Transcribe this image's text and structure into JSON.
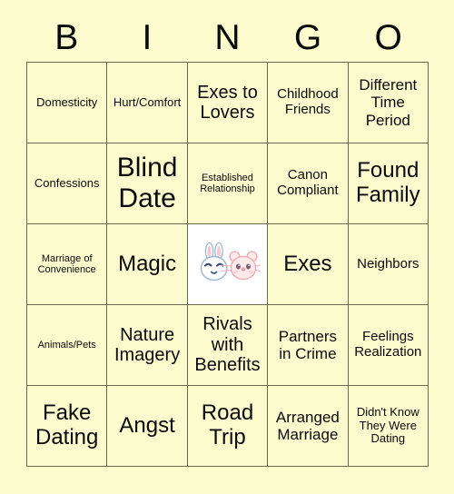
{
  "card": {
    "header_letters": [
      "B",
      "I",
      "N",
      "G",
      "O"
    ],
    "background_color": "#fcfbce",
    "grid_line_color": "#6b6a4a",
    "text_color": "#0a0a0a",
    "free_space_background": "#ffffff"
  },
  "grid": {
    "rows": 5,
    "columns": 5,
    "cells": [
      {
        "id": "b1",
        "text": "Domesticity",
        "size": "sm",
        "type": "text"
      },
      {
        "id": "i1",
        "text": "Hurt/Comfort",
        "size": "sm",
        "type": "text"
      },
      {
        "id": "n1",
        "text": "Exes to Lovers",
        "size": "xl",
        "type": "text"
      },
      {
        "id": "g1",
        "text": "Childhood Friends",
        "size": "md",
        "type": "text"
      },
      {
        "id": "o1",
        "text": "Different Time Period",
        "size": "lg",
        "type": "text"
      },
      {
        "id": "b2",
        "text": "Confessions",
        "size": "sm",
        "type": "text"
      },
      {
        "id": "i2",
        "text": "Blind Date",
        "size": "3xl",
        "type": "text"
      },
      {
        "id": "n2",
        "text": "Established Relationship",
        "size": "xs",
        "type": "text"
      },
      {
        "id": "g2",
        "text": "Canon Compliant",
        "size": "md",
        "type": "text"
      },
      {
        "id": "o2",
        "text": "Found Family",
        "size": "2xl",
        "type": "text"
      },
      {
        "id": "b3",
        "text": "Marriage of Convenience",
        "size": "xs",
        "type": "text"
      },
      {
        "id": "i3",
        "text": "Magic",
        "size": "2xl",
        "type": "text"
      },
      {
        "id": "n3",
        "text": "",
        "size": "md",
        "type": "free-space",
        "art": "bunny-and-cat-illustration"
      },
      {
        "id": "g3",
        "text": "Exes",
        "size": "2xl",
        "type": "text"
      },
      {
        "id": "o3",
        "text": "Neighbors",
        "size": "md",
        "type": "text"
      },
      {
        "id": "b4",
        "text": "Animals/Pets",
        "size": "xs",
        "type": "text"
      },
      {
        "id": "i4",
        "text": "Nature Imagery",
        "size": "xl",
        "type": "text"
      },
      {
        "id": "n4",
        "text": "Rivals with Benefits",
        "size": "xl",
        "type": "text"
      },
      {
        "id": "g4",
        "text": "Partners in Crime",
        "size": "lg",
        "type": "text"
      },
      {
        "id": "o4",
        "text": "Feelings Realization",
        "size": "md",
        "type": "text"
      },
      {
        "id": "b5",
        "text": "Fake Dating",
        "size": "2xl",
        "type": "text"
      },
      {
        "id": "i5",
        "text": "Angst",
        "size": "2xl",
        "type": "text"
      },
      {
        "id": "n5",
        "text": "Road Trip",
        "size": "2xl",
        "type": "text"
      },
      {
        "id": "g5",
        "text": "Arranged Marriage",
        "size": "lg",
        "type": "text"
      },
      {
        "id": "o5",
        "text": "Didn't Know They Were Dating",
        "size": "sm",
        "type": "text"
      }
    ]
  }
}
